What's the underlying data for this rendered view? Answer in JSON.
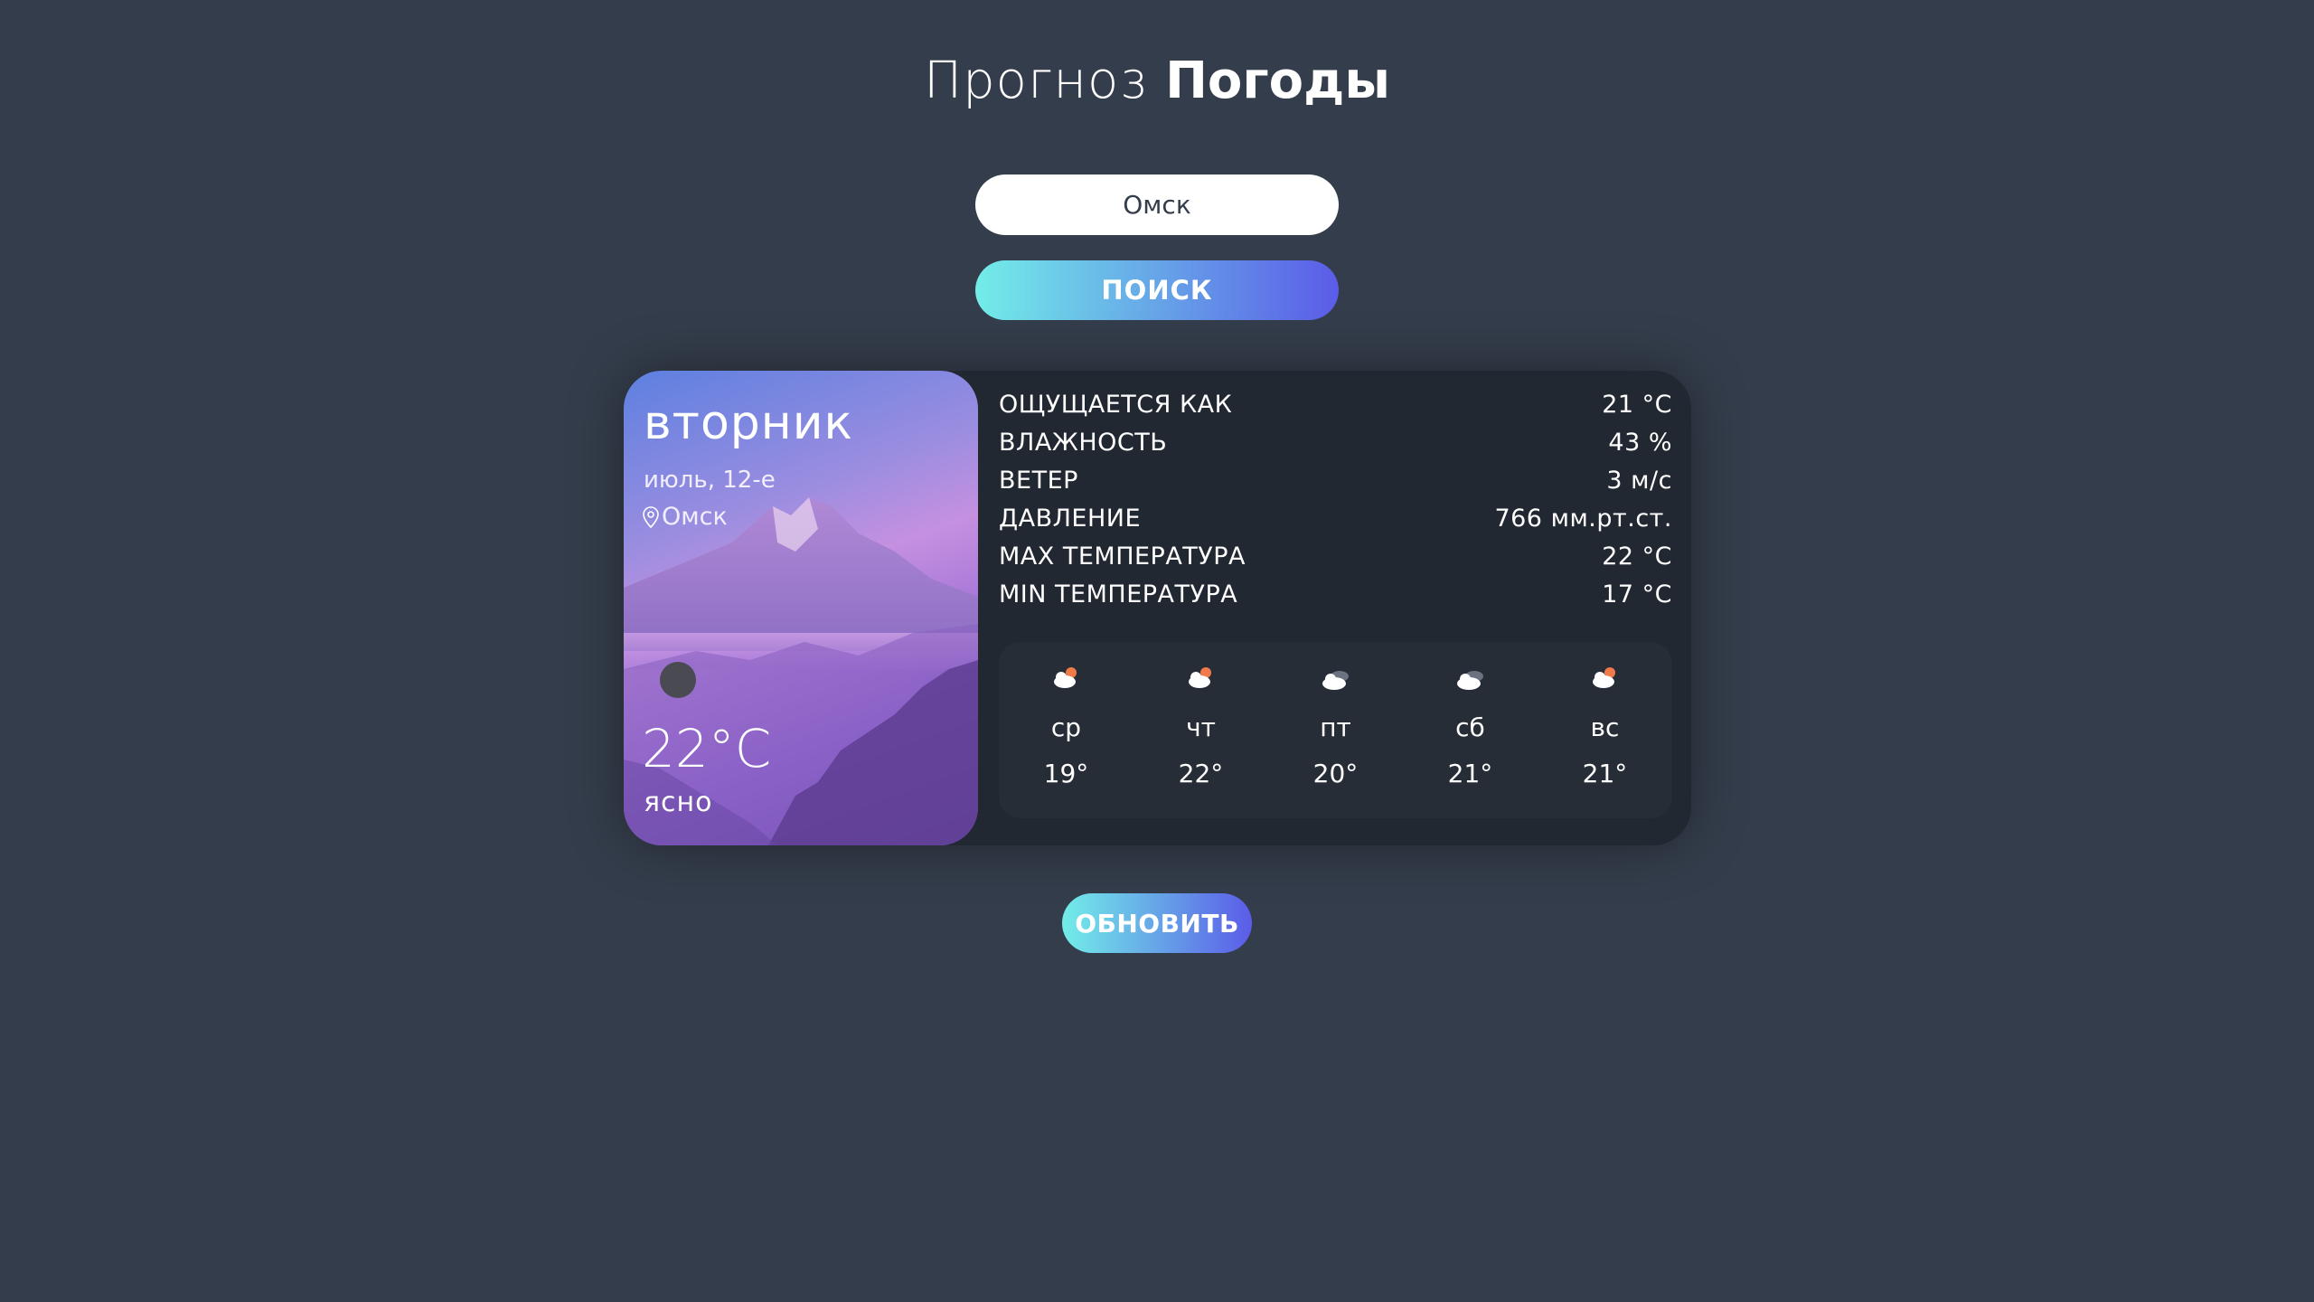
{
  "header": {
    "title_light": "Прогноз",
    "title_bold": "Погоды"
  },
  "search": {
    "value": "Омск",
    "placeholder": "",
    "button_label": "ПОИСК"
  },
  "today": {
    "weekday": "вторник",
    "date": "июль, 12-е",
    "location": "Омск",
    "temperature": "22°C",
    "description": "ясно",
    "icon": "clear-weather-icon"
  },
  "details": [
    {
      "label": "ОЩУЩАЕТСЯ КАК",
      "value": "21 °C"
    },
    {
      "label": "ВЛАЖНОСТЬ",
      "value": "43 %"
    },
    {
      "label": "ВЕТЕР",
      "value": "3 м/с"
    },
    {
      "label": "ДАВЛЕНИЕ",
      "value": "766 мм.рт.ст."
    },
    {
      "label": "MAX ТЕМПЕРАТУРА",
      "value": "22 °C"
    },
    {
      "label": "MIN ТЕМПЕРАТУРА",
      "value": "17 °C"
    }
  ],
  "forecast": [
    {
      "day": "ср",
      "temp": "19°",
      "icon": "partly-cloudy-day-icon"
    },
    {
      "day": "чт",
      "temp": "22°",
      "icon": "partly-cloudy-day-icon"
    },
    {
      "day": "пт",
      "temp": "20°",
      "icon": "broken-clouds-icon"
    },
    {
      "day": "сб",
      "temp": "21°",
      "icon": "broken-clouds-icon"
    },
    {
      "day": "вс",
      "temp": "21°",
      "icon": "partly-cloudy-day-icon"
    }
  ],
  "refresh": {
    "button_label": "ОБНОВИТЬ"
  },
  "colors": {
    "background": "#343d4b",
    "card": "#222831",
    "accent_start": "#72ede8",
    "accent_end": "#5b5ce8"
  }
}
